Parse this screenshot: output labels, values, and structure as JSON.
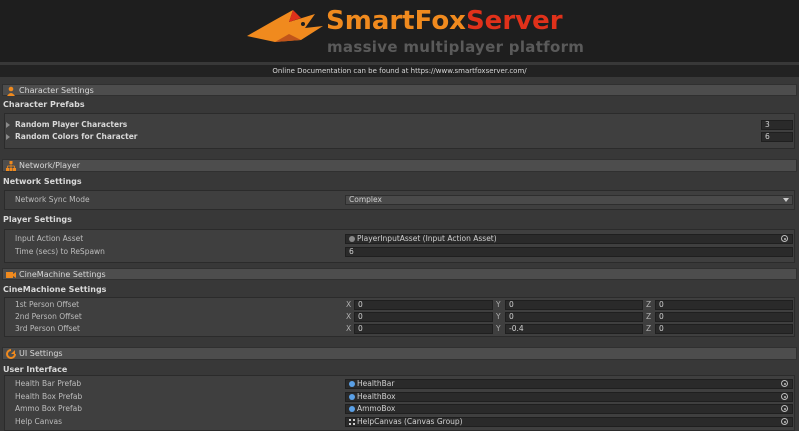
{
  "header": {
    "brand_part1": "SmartFox",
    "brand_part2": "Server",
    "tagline": "massive multiplayer platform",
    "doc_note": "Online Documentation can be found at https://www.smartfoxserver.com/"
  },
  "character": {
    "section_title": "Character Settings",
    "group_title": "Character Prefabs",
    "rows": [
      {
        "label": "Random Player Characters",
        "value": "3"
      },
      {
        "label": "Random Colors for Character",
        "value": "6"
      }
    ]
  },
  "network": {
    "section_title": "Network/Player",
    "group_title": "Network Settings",
    "sync_label": "Network Sync Mode",
    "sync_value": "Complex",
    "player_group_title": "Player Settings",
    "input_label": "Input Action Asset",
    "input_value": "PlayerInputAsset (Input Action Asset)",
    "respawn_label": "Time (secs) to ReSpawn",
    "respawn_value": "6"
  },
  "cinemachine": {
    "section_title": "CineMachine Settings",
    "group_title": "CineMachione Settings",
    "axis_x": "X",
    "axis_y": "Y",
    "axis_z": "Z",
    "rows": [
      {
        "label": "1st Person Offset",
        "x": "0",
        "y": "0",
        "z": "0"
      },
      {
        "label": "2nd Person Offset",
        "x": "0",
        "y": "0",
        "z": "0"
      },
      {
        "label": "3rd Person Offset",
        "x": "0",
        "y": "-0.4",
        "z": "0"
      }
    ]
  },
  "ui": {
    "section_title": "UI Settings",
    "group_title": "User Interface",
    "rows": [
      {
        "label": "Health Bar Prefab",
        "value": "HealthBar",
        "icon": "prefab-icon"
      },
      {
        "label": "Health Box Prefab",
        "value": "HealthBox",
        "icon": "prefab-icon"
      },
      {
        "label": "Ammo Box Prefab",
        "value": "AmmoBox",
        "icon": "prefab-icon"
      },
      {
        "label": "Help Canvas",
        "value": "HelpCanvas (Canvas Group)",
        "icon": "canvas-group-icon"
      }
    ]
  },
  "colors": {
    "brand_orange": "#f08a1e",
    "brand_red": "#e0311a",
    "section_icon_orange": "#f08a1e",
    "prefab_blue": "#5aa0e6"
  }
}
